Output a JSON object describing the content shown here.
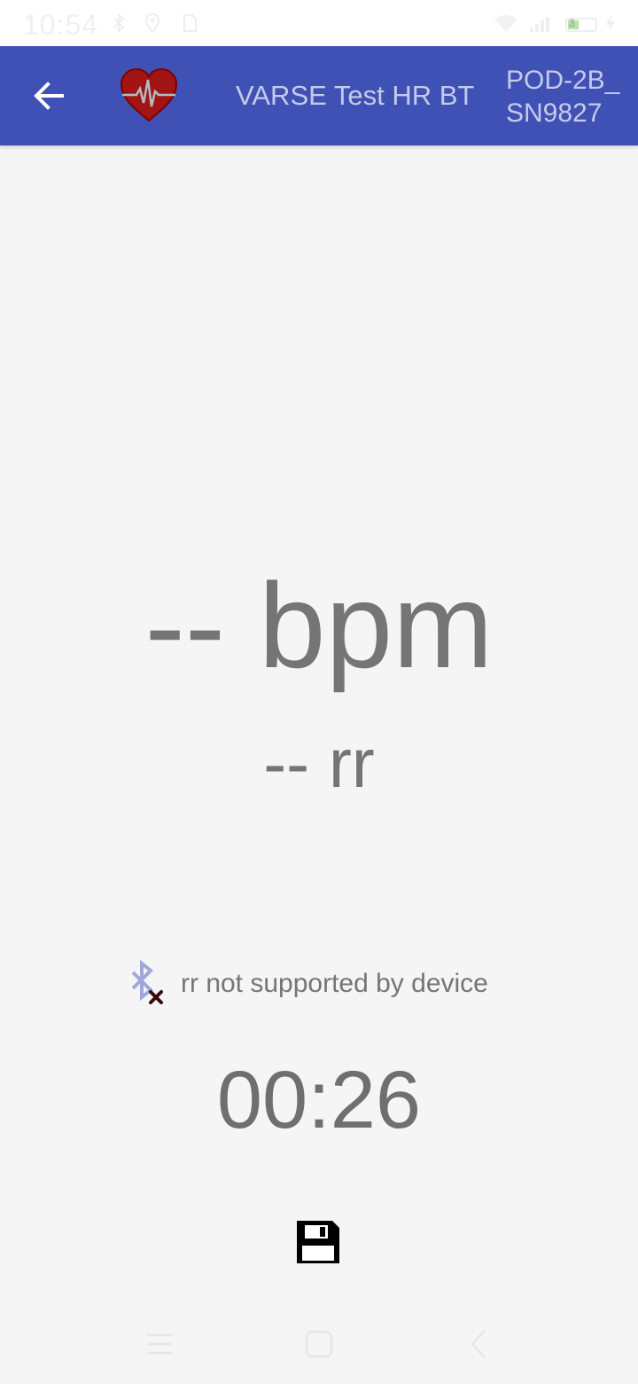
{
  "status_bar": {
    "time": "10:54",
    "battery_level": "3",
    "icons": [
      "bluetooth-icon",
      "location-icon",
      "sim-icon",
      "wifi-icon",
      "signal-icon",
      "battery-icon",
      "charging-icon"
    ]
  },
  "app_bar": {
    "back_icon": "arrow-left-icon",
    "logo_icon": "heart-pulse-icon",
    "title": "VARSE   Test HR BT",
    "device_name": "POD-2B_\nSN9827"
  },
  "main": {
    "bpm_display": "-- bpm",
    "rr_display": "-- rr",
    "rr_status_icon": "bluetooth-disabled-icon",
    "rr_status_text": "rr not supported by device",
    "timer": "00:26",
    "save_icon": "floppy-disk-icon"
  },
  "nav_bar": {
    "items": [
      "menu-icon",
      "home-icon",
      "back-icon"
    ]
  },
  "colors": {
    "app_bar": "#3f51b5",
    "app_bar_text": "#c5cae9",
    "heart": "#b71c1c",
    "text_gray": "#757575",
    "background": "#f5f5f5"
  }
}
